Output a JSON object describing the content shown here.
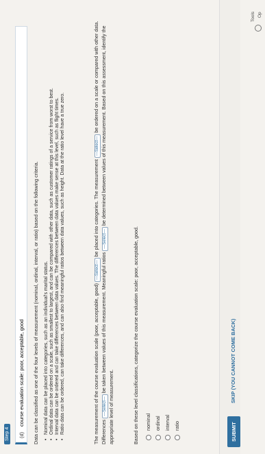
{
  "step": "Step 4",
  "part": {
    "letter": "(d)",
    "prompt": "course evaluation scale: poor, acceptable, good"
  },
  "intro": "Data can be classified as one of the four levels of measurement (nominal, ordinal, interval, or ratio) based on the following criteria.",
  "bullets": [
    "Nominal data can be placed into categories, such as an individual's marital status.",
    "Ordinal data can be ordered on a scale, such as smallest to largest, and can be compared with other data, such as customer ratings of a service from worst to best.",
    "Interval data can be ordered and can take differences between data values. The differences between data values make sense at this level, such as flight times.",
    "Ratio data can be ordered, can take differences, and can also find meaningful ratios between data values, such as height. Data at the ratio level have a true zero."
  ],
  "measurement": {
    "t1": "The measurement of the course evaluation scale (poor, acceptable, good)",
    "t2": "be placed into categories. The measurement",
    "t3": "be ordered on a scale or compared with other data. Differences",
    "t4": "be taken between values of this measurement. Meaningful ratios",
    "t5": "be determined between values of this measurement. Based on this assessment, identify the appropriate level of measurement.",
    "select_label": "---Select---"
  },
  "question": "Based on these level classifications, categorize the course evaluation scale: poor, acceptable, good.",
  "options": [
    "nominal",
    "ordinal",
    "interval",
    "ratio"
  ],
  "buttons": {
    "submit": "SUBMIT",
    "skip": "SKIP (YOU CANNOT COME BACK)"
  },
  "tools": {
    "t1": "Tools",
    "t2": "Op"
  }
}
